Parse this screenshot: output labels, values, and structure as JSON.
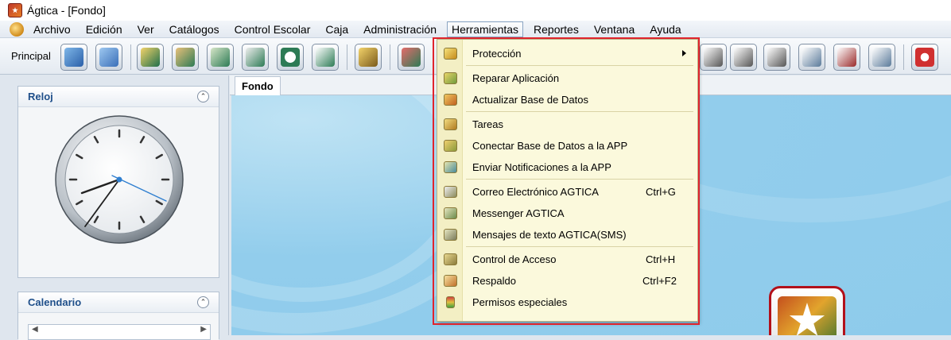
{
  "window": {
    "title": "Ágtica - [Fondo]"
  },
  "menubar": {
    "items": [
      "Archivo",
      "Edición",
      "Ver",
      "Catálogos",
      "Control Escolar",
      "Caja",
      "Administración",
      "Herramientas",
      "Reportes",
      "Ventana",
      "Ayuda"
    ],
    "active": "Herramientas"
  },
  "toolbar": {
    "label": "Principal"
  },
  "left_panel": {
    "clock_title": "Reloj",
    "calendar_title": "Calendario"
  },
  "content": {
    "tab": "Fondo"
  },
  "dropdown": {
    "items": [
      {
        "label": "Protección",
        "shortcut": "",
        "submenu": true,
        "icon": "shield-icon"
      },
      {
        "label": "Reparar Aplicación",
        "shortcut": "",
        "icon": "repair-icon"
      },
      {
        "label": "Actualizar Base de Datos",
        "shortcut": "",
        "icon": "database-update-icon"
      },
      {
        "label": "Tareas",
        "shortcut": "",
        "icon": "tasks-icon"
      },
      {
        "label": "Conectar Base de Datos a la APP",
        "shortcut": "",
        "icon": "database-connect-icon"
      },
      {
        "label": "Enviar Notificaciones a la APP",
        "shortcut": "",
        "icon": "notification-icon"
      },
      {
        "label": "Correo Electrónico AGTICA",
        "shortcut": "Ctrl+G",
        "icon": "email-icon"
      },
      {
        "label": "Messenger AGTICA",
        "shortcut": "",
        "icon": "messenger-icon"
      },
      {
        "label": "Mensajes de texto AGTICA(SMS)",
        "shortcut": "",
        "icon": "sms-icon"
      },
      {
        "label": "Control de Acceso",
        "shortcut": "Ctrl+H",
        "icon": "access-control-icon"
      },
      {
        "label": "Respaldo",
        "shortcut": "Ctrl+F2",
        "icon": "backup-icon"
      },
      {
        "label": "Permisos especiales",
        "shortcut": "",
        "icon": "traffic-light-icon"
      }
    ]
  },
  "colors": {
    "highlight_border": "#e0242c",
    "menu_background": "#fbf9dc",
    "panel_title": "#1f4f8a",
    "canvas_background": "#8ecbeb"
  }
}
